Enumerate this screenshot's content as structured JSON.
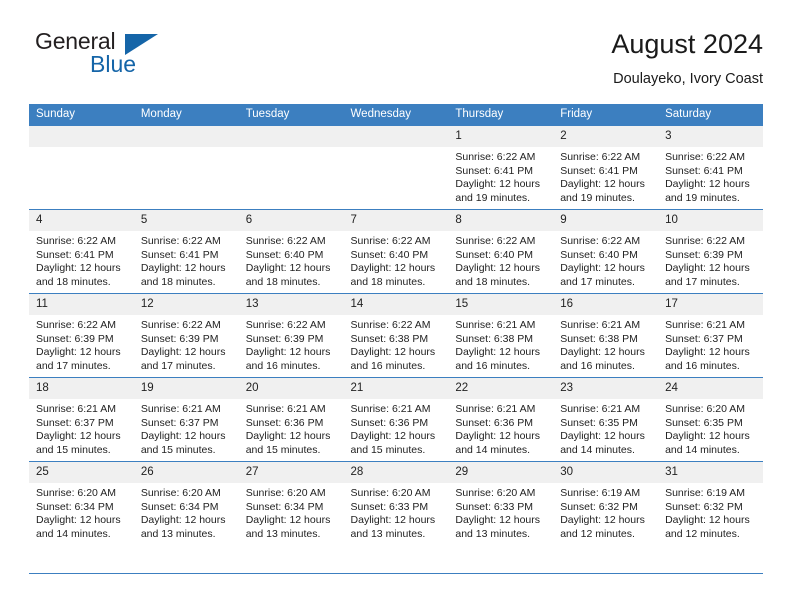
{
  "brand": {
    "name_line1": "General",
    "name_line2": "Blue",
    "triangle_color": "#1565a8",
    "text_color": "#231f20"
  },
  "header": {
    "title": "August 2024",
    "subtitle": "Doulayeko, Ivory Coast"
  },
  "theme": {
    "header_blue": "#3c7fc0",
    "daynum_band": "#f0f0f0",
    "text": "#222222"
  },
  "weekday_headers": [
    "Sunday",
    "Monday",
    "Tuesday",
    "Wednesday",
    "Thursday",
    "Friday",
    "Saturday"
  ],
  "labels": {
    "sunrise_prefix": "Sunrise:",
    "sunset_prefix": "Sunset:",
    "daylight_prefix": "Daylight:"
  },
  "weeks": [
    [
      {
        "day": "",
        "blank": true,
        "sunrise": "",
        "sunset": "",
        "daylight_line1": "",
        "daylight_line2": ""
      },
      {
        "day": "",
        "blank": true,
        "sunrise": "",
        "sunset": "",
        "daylight_line1": "",
        "daylight_line2": ""
      },
      {
        "day": "",
        "blank": true,
        "sunrise": "",
        "sunset": "",
        "daylight_line1": "",
        "daylight_line2": ""
      },
      {
        "day": "",
        "blank": true,
        "sunrise": "",
        "sunset": "",
        "daylight_line1": "",
        "daylight_line2": ""
      },
      {
        "day": "1",
        "blank": false,
        "sunrise": "Sunrise: 6:22 AM",
        "sunset": "Sunset: 6:41 PM",
        "daylight_line1": "Daylight: 12 hours",
        "daylight_line2": "and 19 minutes."
      },
      {
        "day": "2",
        "blank": false,
        "sunrise": "Sunrise: 6:22 AM",
        "sunset": "Sunset: 6:41 PM",
        "daylight_line1": "Daylight: 12 hours",
        "daylight_line2": "and 19 minutes."
      },
      {
        "day": "3",
        "blank": false,
        "sunrise": "Sunrise: 6:22 AM",
        "sunset": "Sunset: 6:41 PM",
        "daylight_line1": "Daylight: 12 hours",
        "daylight_line2": "and 19 minutes."
      }
    ],
    [
      {
        "day": "4",
        "blank": false,
        "sunrise": "Sunrise: 6:22 AM",
        "sunset": "Sunset: 6:41 PM",
        "daylight_line1": "Daylight: 12 hours",
        "daylight_line2": "and 18 minutes."
      },
      {
        "day": "5",
        "blank": false,
        "sunrise": "Sunrise: 6:22 AM",
        "sunset": "Sunset: 6:41 PM",
        "daylight_line1": "Daylight: 12 hours",
        "daylight_line2": "and 18 minutes."
      },
      {
        "day": "6",
        "blank": false,
        "sunrise": "Sunrise: 6:22 AM",
        "sunset": "Sunset: 6:40 PM",
        "daylight_line1": "Daylight: 12 hours",
        "daylight_line2": "and 18 minutes."
      },
      {
        "day": "7",
        "blank": false,
        "sunrise": "Sunrise: 6:22 AM",
        "sunset": "Sunset: 6:40 PM",
        "daylight_line1": "Daylight: 12 hours",
        "daylight_line2": "and 18 minutes."
      },
      {
        "day": "8",
        "blank": false,
        "sunrise": "Sunrise: 6:22 AM",
        "sunset": "Sunset: 6:40 PM",
        "daylight_line1": "Daylight: 12 hours",
        "daylight_line2": "and 18 minutes."
      },
      {
        "day": "9",
        "blank": false,
        "sunrise": "Sunrise: 6:22 AM",
        "sunset": "Sunset: 6:40 PM",
        "daylight_line1": "Daylight: 12 hours",
        "daylight_line2": "and 17 minutes."
      },
      {
        "day": "10",
        "blank": false,
        "sunrise": "Sunrise: 6:22 AM",
        "sunset": "Sunset: 6:39 PM",
        "daylight_line1": "Daylight: 12 hours",
        "daylight_line2": "and 17 minutes."
      }
    ],
    [
      {
        "day": "11",
        "blank": false,
        "sunrise": "Sunrise: 6:22 AM",
        "sunset": "Sunset: 6:39 PM",
        "daylight_line1": "Daylight: 12 hours",
        "daylight_line2": "and 17 minutes."
      },
      {
        "day": "12",
        "blank": false,
        "sunrise": "Sunrise: 6:22 AM",
        "sunset": "Sunset: 6:39 PM",
        "daylight_line1": "Daylight: 12 hours",
        "daylight_line2": "and 17 minutes."
      },
      {
        "day": "13",
        "blank": false,
        "sunrise": "Sunrise: 6:22 AM",
        "sunset": "Sunset: 6:39 PM",
        "daylight_line1": "Daylight: 12 hours",
        "daylight_line2": "and 16 minutes."
      },
      {
        "day": "14",
        "blank": false,
        "sunrise": "Sunrise: 6:22 AM",
        "sunset": "Sunset: 6:38 PM",
        "daylight_line1": "Daylight: 12 hours",
        "daylight_line2": "and 16 minutes."
      },
      {
        "day": "15",
        "blank": false,
        "sunrise": "Sunrise: 6:21 AM",
        "sunset": "Sunset: 6:38 PM",
        "daylight_line1": "Daylight: 12 hours",
        "daylight_line2": "and 16 minutes."
      },
      {
        "day": "16",
        "blank": false,
        "sunrise": "Sunrise: 6:21 AM",
        "sunset": "Sunset: 6:38 PM",
        "daylight_line1": "Daylight: 12 hours",
        "daylight_line2": "and 16 minutes."
      },
      {
        "day": "17",
        "blank": false,
        "sunrise": "Sunrise: 6:21 AM",
        "sunset": "Sunset: 6:37 PM",
        "daylight_line1": "Daylight: 12 hours",
        "daylight_line2": "and 16 minutes."
      }
    ],
    [
      {
        "day": "18",
        "blank": false,
        "sunrise": "Sunrise: 6:21 AM",
        "sunset": "Sunset: 6:37 PM",
        "daylight_line1": "Daylight: 12 hours",
        "daylight_line2": "and 15 minutes."
      },
      {
        "day": "19",
        "blank": false,
        "sunrise": "Sunrise: 6:21 AM",
        "sunset": "Sunset: 6:37 PM",
        "daylight_line1": "Daylight: 12 hours",
        "daylight_line2": "and 15 minutes."
      },
      {
        "day": "20",
        "blank": false,
        "sunrise": "Sunrise: 6:21 AM",
        "sunset": "Sunset: 6:36 PM",
        "daylight_line1": "Daylight: 12 hours",
        "daylight_line2": "and 15 minutes."
      },
      {
        "day": "21",
        "blank": false,
        "sunrise": "Sunrise: 6:21 AM",
        "sunset": "Sunset: 6:36 PM",
        "daylight_line1": "Daylight: 12 hours",
        "daylight_line2": "and 15 minutes."
      },
      {
        "day": "22",
        "blank": false,
        "sunrise": "Sunrise: 6:21 AM",
        "sunset": "Sunset: 6:36 PM",
        "daylight_line1": "Daylight: 12 hours",
        "daylight_line2": "and 14 minutes."
      },
      {
        "day": "23",
        "blank": false,
        "sunrise": "Sunrise: 6:21 AM",
        "sunset": "Sunset: 6:35 PM",
        "daylight_line1": "Daylight: 12 hours",
        "daylight_line2": "and 14 minutes."
      },
      {
        "day": "24",
        "blank": false,
        "sunrise": "Sunrise: 6:20 AM",
        "sunset": "Sunset: 6:35 PM",
        "daylight_line1": "Daylight: 12 hours",
        "daylight_line2": "and 14 minutes."
      }
    ],
    [
      {
        "day": "25",
        "blank": false,
        "sunrise": "Sunrise: 6:20 AM",
        "sunset": "Sunset: 6:34 PM",
        "daylight_line1": "Daylight: 12 hours",
        "daylight_line2": "and 14 minutes."
      },
      {
        "day": "26",
        "blank": false,
        "sunrise": "Sunrise: 6:20 AM",
        "sunset": "Sunset: 6:34 PM",
        "daylight_line1": "Daylight: 12 hours",
        "daylight_line2": "and 13 minutes."
      },
      {
        "day": "27",
        "blank": false,
        "sunrise": "Sunrise: 6:20 AM",
        "sunset": "Sunset: 6:34 PM",
        "daylight_line1": "Daylight: 12 hours",
        "daylight_line2": "and 13 minutes."
      },
      {
        "day": "28",
        "blank": false,
        "sunrise": "Sunrise: 6:20 AM",
        "sunset": "Sunset: 6:33 PM",
        "daylight_line1": "Daylight: 12 hours",
        "daylight_line2": "and 13 minutes."
      },
      {
        "day": "29",
        "blank": false,
        "sunrise": "Sunrise: 6:20 AM",
        "sunset": "Sunset: 6:33 PM",
        "daylight_line1": "Daylight: 12 hours",
        "daylight_line2": "and 13 minutes."
      },
      {
        "day": "30",
        "blank": false,
        "sunrise": "Sunrise: 6:19 AM",
        "sunset": "Sunset: 6:32 PM",
        "daylight_line1": "Daylight: 12 hours",
        "daylight_line2": "and 12 minutes."
      },
      {
        "day": "31",
        "blank": false,
        "sunrise": "Sunrise: 6:19 AM",
        "sunset": "Sunset: 6:32 PM",
        "daylight_line1": "Daylight: 12 hours",
        "daylight_line2": "and 12 minutes."
      }
    ]
  ]
}
